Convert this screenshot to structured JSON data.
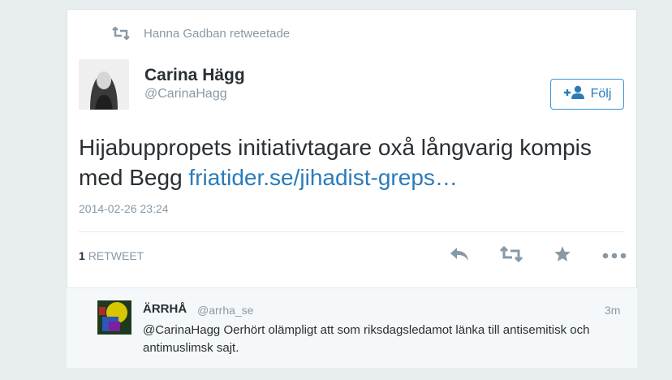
{
  "context": {
    "retweeted_by": "Hanna Gadban retweetade"
  },
  "tweet": {
    "author_name": "Carina Hägg",
    "author_handle": "@CarinaHagg",
    "follow_label": "Följ",
    "text": "Hijabuppropets initiativtagare oxå långvarig kompis med Begg ",
    "link": "friatider.se/jihadist-greps…",
    "timestamp": "2014-02-26 23:24",
    "retweet_count": "1",
    "retweet_label": "RETWEET"
  },
  "reply": {
    "author_name": "ÄRRHÅ",
    "author_handle": "@arrha_se",
    "time": "3m",
    "text": "@CarinaHagg Oerhört olämpligt att som riksdagsledamot länka till antisemitisk och antimuslimsk sajt."
  },
  "colors": {
    "link": "#2b7bb9",
    "muted": "#8899a6",
    "text": "#292f33",
    "background": "#e8edf0"
  },
  "icons": [
    "retweet-icon",
    "follow-user-icon",
    "reply-icon",
    "favorite-icon",
    "more-icon"
  ]
}
